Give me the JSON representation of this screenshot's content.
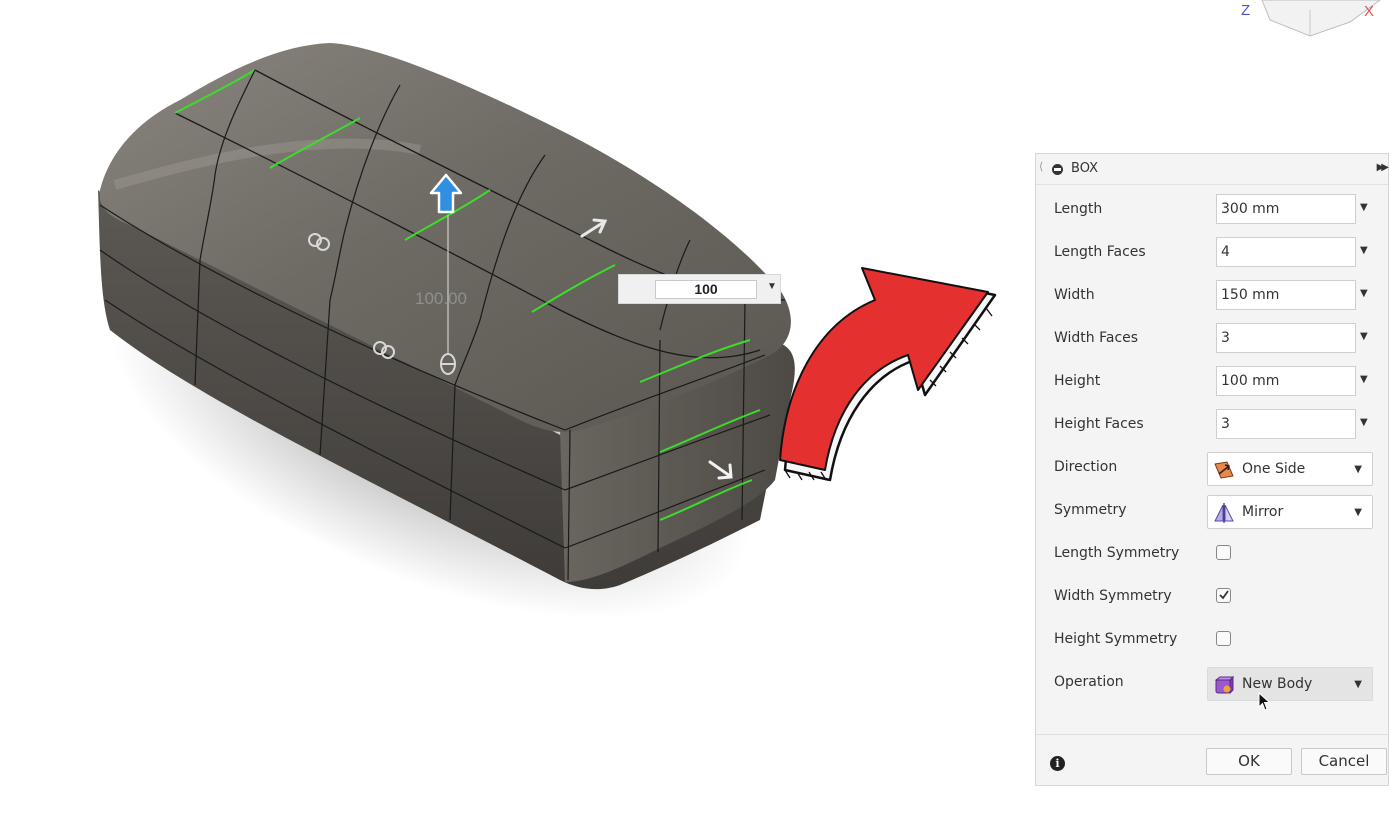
{
  "viewport": {
    "dimension_label": "100.00",
    "dimension_input_value": "100",
    "viewcube": {
      "axis_z": "Z",
      "axis_x": "X"
    }
  },
  "panel": {
    "title": "BOX",
    "fields": [
      {
        "label": "Length",
        "value": "300 mm"
      },
      {
        "label": "Length Faces",
        "value": "4"
      },
      {
        "label": "Width",
        "value": "150 mm"
      },
      {
        "label": "Width Faces",
        "value": "3"
      },
      {
        "label": "Height",
        "value": "100 mm"
      },
      {
        "label": "Height Faces",
        "value": "3"
      }
    ],
    "direction": {
      "label": "Direction",
      "value": "One Side"
    },
    "symmetry": {
      "label": "Symmetry",
      "value": "Mirror"
    },
    "length_symmetry": {
      "label": "Length Symmetry",
      "checked": false
    },
    "width_symmetry": {
      "label": "Width Symmetry",
      "checked": true
    },
    "height_symmetry": {
      "label": "Height Symmetry",
      "checked": false
    },
    "operation": {
      "label": "Operation",
      "value": "New Body"
    },
    "ok_label": "OK",
    "cancel_label": "Cancel"
  },
  "colors": {
    "mesh_body": "#5f5a55",
    "edge_highlight": "#3ddc2c",
    "manipulator_arrow": "#2f8fe0",
    "callout_arrow": "#e53030"
  }
}
